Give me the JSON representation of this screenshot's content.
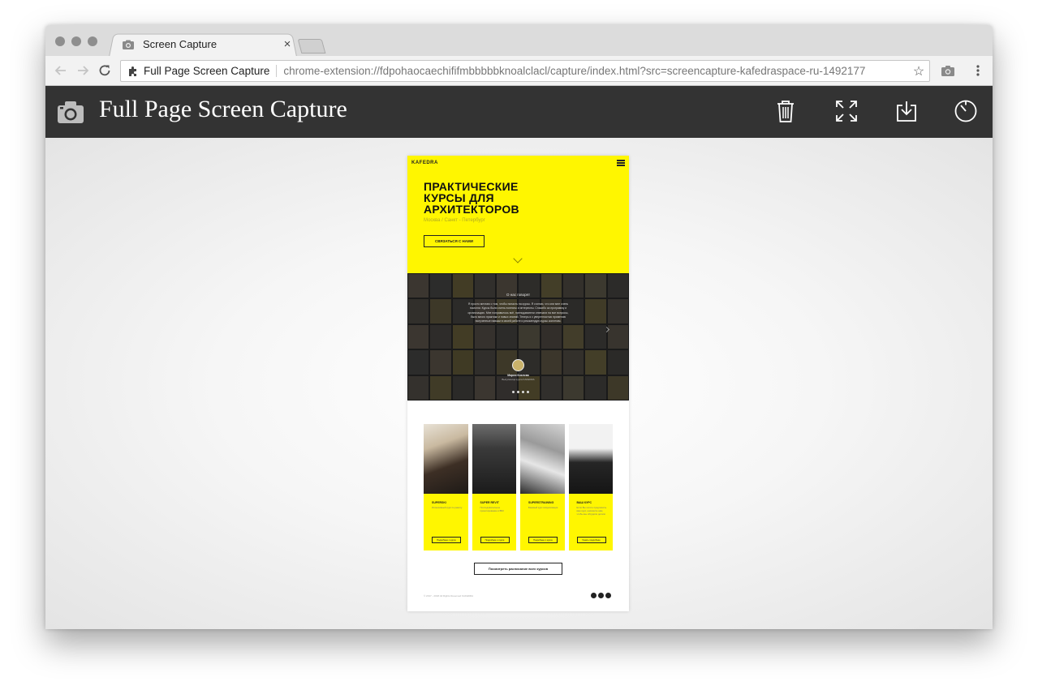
{
  "browser": {
    "tab_title": "Screen Capture",
    "tab_close": "×",
    "omnibox_label": "Full Page Screen Capture",
    "url": "chrome-extension://fdpohaocaechififmbbbbbknoalclacl/capture/index.html?src=screencapture-kafedraspace-ru-1492177"
  },
  "app": {
    "title": "Full Page Screen Capture",
    "icons": [
      "camera-icon",
      "trash-icon",
      "fullscreen-icon",
      "download-icon",
      "timer-icon"
    ]
  },
  "capture": {
    "logo": "KAFEDRA",
    "hero_title": "ПРАКТИЧЕСКИЕ КУРСЫ ДЛЯ АРХИТЕКТОРОВ",
    "hero_subtitle": "Москва / Санкт - Петербург",
    "hero_button": "СВЯЗАТЬСЯ С НАМИ",
    "testimonial_heading": "О нас говорят",
    "testimonial_text": "Я просто мечтаю о том, чтобы попасть на курсы. Я считаю, что они мне очень помогли. Курсы были очень полезны и интересны. Спасибо за программу и организацию. Мне понравилось всё, преподаватели отвечали на все вопросы, было много практики и новых знаний. Теперь я с уверенностью применяю полученные навыки в своей работе и рекомендую курсы коллегам.",
    "testimonial_name": "Мария Козлова",
    "testimonial_role": "Выпускница курса KAFEDRA",
    "courses": [
      {
        "name": "SUPERSKI",
        "desc": "Интенсивный курс по ревиту",
        "button": "Подробнее о курсе"
      },
      {
        "name": "SUPER REVIT",
        "desc": "Последовательное проектирование в BIM",
        "button": "Подробнее о курсе"
      },
      {
        "name": "SUPERSTRAINING",
        "desc": "Базовый курс визуализации",
        "button": "Подробнее о курсе"
      },
      {
        "name": "ВАШ КУРС",
        "desc": "Если Вы хотите предложить ваш курс, напишите нам, чтобы мы обсудили детали",
        "button": "Узнать подробнее"
      }
    ],
    "all_courses_button": "Посмотреть расписание всех курсов",
    "footer_text": "© 2017 - 2018 All Rights Reserved KAFEDRA"
  }
}
